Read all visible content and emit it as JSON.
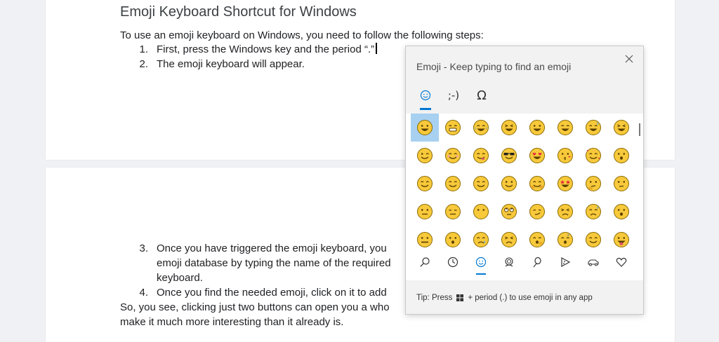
{
  "document": {
    "title": "Emoji Keyboard Shortcut for Windows",
    "intro": "To use an emoji keyboard on Windows, you need to follow the following steps:",
    "steps": [
      {
        "num": "1.",
        "text": "First, press the Windows key and the period “.”"
      },
      {
        "num": "2.",
        "text": "The emoji keyboard will appear."
      },
      {
        "num": "3.",
        "lines": [
          "Once you have triggered the emoji keyboard, you",
          "emoji database by typing the name of the required",
          "keyboard."
        ]
      },
      {
        "num": "4.",
        "text": "Once you find the needed emoji, click on it to add"
      }
    ],
    "outro_lines": [
      "So, you see, clicking just two buttons can open you a who",
      "make it much more interesting than it already is."
    ]
  },
  "emoji_panel": {
    "title": "Emoji - Keep typing to find an emoji",
    "tabs": [
      {
        "name": "emoji-tab",
        "label": "☺",
        "active": true
      },
      {
        "name": "kaomoji-tab",
        "label": ";-)",
        "active": false
      },
      {
        "name": "symbols-tab",
        "label": "Ω",
        "active": false
      }
    ],
    "emojis": [
      "grinning",
      "grin-teeth",
      "joy",
      "rofl",
      "smiley",
      "smile",
      "sweat-smile",
      "laughing",
      "wink",
      "blush",
      "yum",
      "sunglasses",
      "heart-eyes",
      "kiss",
      "smiling-hearts",
      "hug-face",
      "relieved",
      "smile-closed",
      "smile-soft",
      "slight-smile",
      "hugging",
      "star-struck",
      "thinking",
      "neutral-raised",
      "neutral",
      "expressionless",
      "no-mouth",
      "eye-roll",
      "smirk",
      "persevere",
      "disappointed-relieved",
      "hushed",
      "zipper",
      "open-mouth",
      "sleepy",
      "tired",
      "yawn",
      "sleeping",
      "relieved-2",
      "tongue"
    ],
    "categories": [
      "search-category",
      "recent-category",
      "smileys-category",
      "people-category",
      "celebration-category",
      "food-category",
      "travel-category",
      "heart-category"
    ],
    "tip": {
      "before": "Tip: Press",
      "after": "+ period (.) to use emoji in any app"
    },
    "colors": {
      "face": "#f7c93b",
      "outline": "#8a6a00",
      "selected": "#a8d0f0",
      "accent": "#0078d4"
    }
  }
}
